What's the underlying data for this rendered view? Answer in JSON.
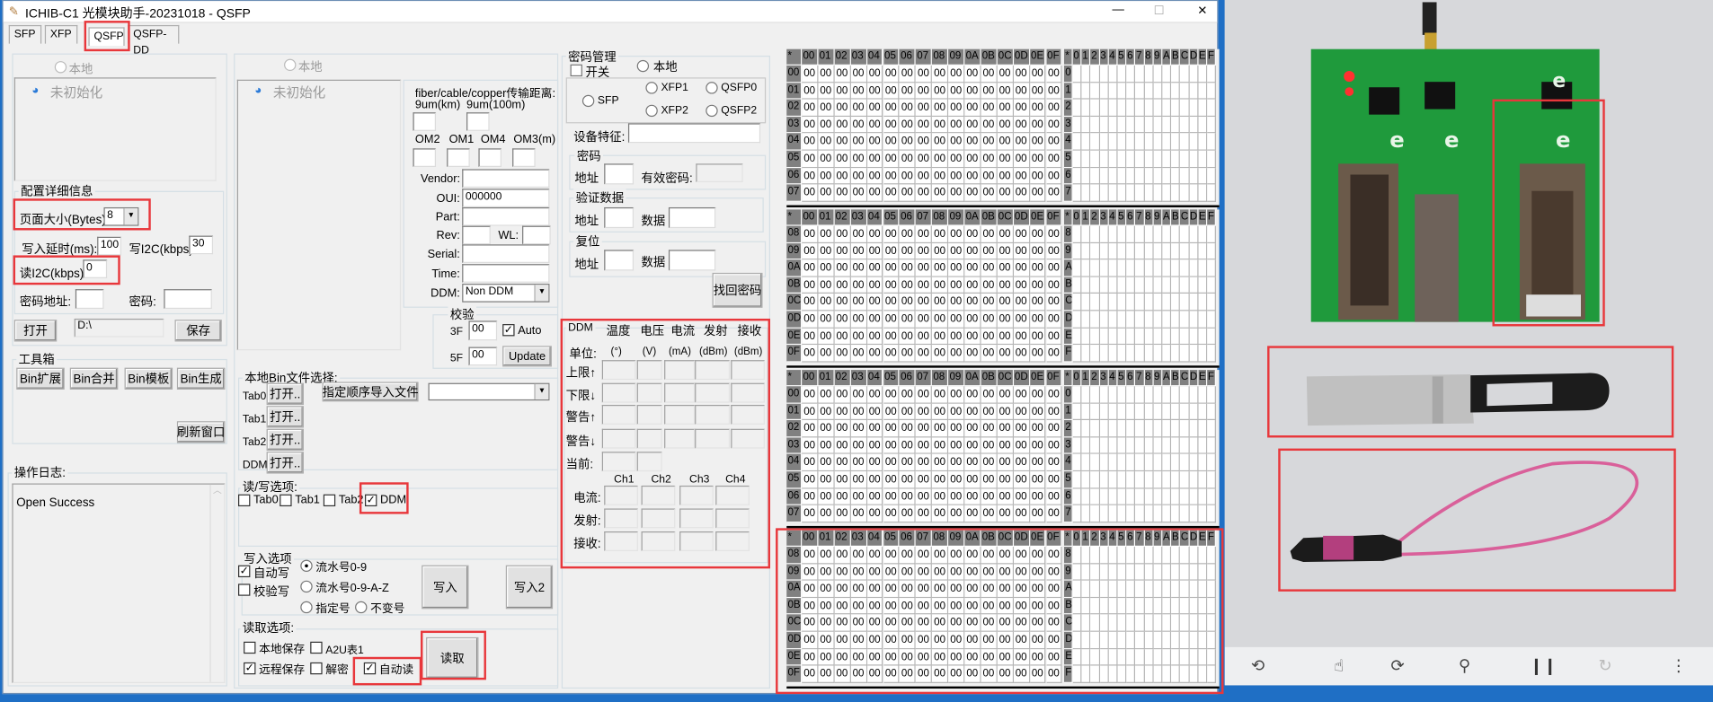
{
  "window": {
    "title": "ICHIB-C1 光模块助手-20231018  - QSFP",
    "min": "—",
    "max": "☐",
    "close": "✕"
  },
  "tabs": [
    {
      "label": "SFP"
    },
    {
      "label": "XFP"
    },
    {
      "label": "QSFP",
      "active": true
    },
    {
      "label": "QSFP-DD"
    }
  ],
  "left": {
    "local_radio": "本地",
    "tree_item": "未初始化",
    "config": {
      "legend": "配置详细信息",
      "page_size_label": "页面大小(Bytes):",
      "page_size": "8",
      "write_delay_label": "写入延时(ms):",
      "write_delay": "100",
      "write_i2c_label": "写I2C(kbps):",
      "write_i2c": "30",
      "read_i2c_label": "读I2C(kbps):",
      "read_i2c": "0",
      "pwd_addr_label": "密码地址:",
      "pwd_addr": "",
      "pwd_label": "密码:",
      "pwd": ""
    },
    "open_btn": "打开",
    "path": "D:\\",
    "save_btn": "保存",
    "toolbox": {
      "legend": "工具箱",
      "buttons": [
        "Bin扩展",
        "Bin合并",
        "Bin模板",
        "Bin生成"
      ],
      "refresh": "刷新窗口"
    },
    "log": {
      "legend": "操作日志:",
      "text": "Open Success"
    }
  },
  "middle": {
    "local_radio": "本地",
    "tree_item": "未初始化",
    "info": {
      "distance_title": "fiber/cable/copper传输距离:",
      "sm_km": "9um(km)",
      "sm_100m": "9um(100m)",
      "om2": "OM2",
      "om1": "OM1",
      "om4": "OM4",
      "om3": "OM3(m)",
      "vendor_label": "Vendor:",
      "vendor": "",
      "oui_label": "OUI:",
      "oui": "000000",
      "part_label": "Part:",
      "part": "",
      "rev_label": "Rev:",
      "rev": "",
      "wl_label": "WL:",
      "wl": "",
      "serial_label": "Serial:",
      "serial": "",
      "time_label": "Time:",
      "time": "",
      "ddm_label": "DDM:",
      "ddm": "Non DDM"
    },
    "checksum": {
      "legend": "校验",
      "f3_label": "3F",
      "f3": "00",
      "auto_label": "Auto",
      "auto": true,
      "f5_label": "5F",
      "f5": "00",
      "update_btn": "Update"
    },
    "bin": {
      "legend": "本地Bin文件选择:",
      "rows": [
        {
          "label": "Tab0",
          "btn": "打开.."
        },
        {
          "label": "Tab1",
          "btn": "打开.."
        },
        {
          "label": "Tab2",
          "btn": "打开.."
        },
        {
          "label": "DDM",
          "btn": "打开.."
        }
      ],
      "import_btn": "指定顺序导入文件",
      "import_select": ""
    },
    "rw": {
      "legend": "读/写选项:",
      "items": [
        {
          "label": "Tab0",
          "checked": false
        },
        {
          "label": "Tab1",
          "checked": false
        },
        {
          "label": "Tab2",
          "checked": false
        },
        {
          "label": "DDM",
          "checked": true
        }
      ]
    },
    "write": {
      "legend": "写入选项",
      "auto_write": "自动写",
      "verify_write": "校验写",
      "serial_09": "流水号0-9",
      "serial_09az": "流水号0-9-A-Z",
      "fixed": "指定号",
      "unchanged": "不变号",
      "write_btn": "写入",
      "write2_btn": "写入2"
    },
    "read": {
      "legend": "读取选项:",
      "local_save": "本地保存",
      "a2u": "A2U表1",
      "remote_save": "远程保存",
      "decrypt": "解密",
      "auto_read": "自动读",
      "read_btn": "读取"
    }
  },
  "password": {
    "legend": "密码管理",
    "switch": "开关",
    "local": "本地",
    "modules": {
      "sfp": "SFP",
      "xfp1": "XFP1",
      "xfp2": "XFP2",
      "qsfp0": "QSFP0",
      "qsfp2": "QSFP2"
    },
    "device_label": "设备特征:",
    "device": "",
    "pwd": {
      "legend": "密码",
      "addr_label": "地址",
      "valid_label": "有效密码:"
    },
    "verify": {
      "legend": "验证数据",
      "addr_label": "地址",
      "data_label": "数据"
    },
    "reset": {
      "legend": "复位",
      "addr_label": "地址",
      "data_label": "数据"
    },
    "recover_btn": "找回密码"
  },
  "ddm": {
    "legend": "DDM",
    "headers": [
      "温度",
      "电压",
      "电流",
      "发射",
      "接收"
    ],
    "unit_label": "单位:",
    "units": [
      "(°)",
      "(V)",
      "(mA)",
      "(dBm)",
      "(dBm)"
    ],
    "rows": [
      "上限↑",
      "下限↓",
      "警告↑",
      "警告↓"
    ],
    "current_label": "当前:",
    "channels": [
      "Ch1",
      "Ch2",
      "Ch3",
      "Ch4"
    ],
    "ch_rows": [
      "电流:",
      "发射:",
      "接收:"
    ]
  },
  "hex": {
    "corner": "*",
    "col_headers": [
      "00",
      "01",
      "02",
      "03",
      "04",
      "05",
      "06",
      "07",
      "08",
      "09",
      "0A",
      "0B",
      "0C",
      "0D",
      "0E",
      "0F"
    ],
    "ascii_headers": [
      "0",
      "1",
      "2",
      "3",
      "4",
      "5",
      "6",
      "7",
      "8",
      "9",
      "A",
      "B",
      "C",
      "D",
      "E",
      "F"
    ],
    "blocks": [
      {
        "rows": [
          {
            "label": "00",
            "ascii_label": "0",
            "values": [
              "00",
              "00",
              "00",
              "00",
              "00",
              "00",
              "00",
              "00",
              "00",
              "00",
              "00",
              "00",
              "00",
              "00",
              "00",
              "00"
            ]
          },
          {
            "label": "01",
            "ascii_label": "1",
            "values": [
              "00",
              "00",
              "00",
              "00",
              "00",
              "00",
              "00",
              "00",
              "00",
              "00",
              "00",
              "00",
              "00",
              "00",
              "00",
              "00"
            ]
          },
          {
            "label": "02",
            "ascii_label": "2",
            "values": [
              "00",
              "00",
              "00",
              "00",
              "00",
              "00",
              "00",
              "00",
              "00",
              "00",
              "00",
              "00",
              "00",
              "00",
              "00",
              "00"
            ]
          },
          {
            "label": "03",
            "ascii_label": "3",
            "values": [
              "00",
              "00",
              "00",
              "00",
              "00",
              "00",
              "00",
              "00",
              "00",
              "00",
              "00",
              "00",
              "00",
              "00",
              "00",
              "00"
            ]
          },
          {
            "label": "04",
            "ascii_label": "4",
            "values": [
              "00",
              "00",
              "00",
              "00",
              "00",
              "00",
              "00",
              "00",
              "00",
              "00",
              "00",
              "00",
              "00",
              "00",
              "00",
              "00"
            ]
          },
          {
            "label": "05",
            "ascii_label": "5",
            "values": [
              "00",
              "00",
              "00",
              "00",
              "00",
              "00",
              "00",
              "00",
              "00",
              "00",
              "00",
              "00",
              "00",
              "00",
              "00",
              "00"
            ]
          },
          {
            "label": "06",
            "ascii_label": "6",
            "values": [
              "00",
              "00",
              "00",
              "00",
              "00",
              "00",
              "00",
              "00",
              "00",
              "00",
              "00",
              "00",
              "00",
              "00",
              "00",
              "00"
            ]
          },
          {
            "label": "07",
            "ascii_label": "7",
            "values": [
              "00",
              "00",
              "00",
              "00",
              "00",
              "00",
              "00",
              "00",
              "00",
              "00",
              "00",
              "00",
              "00",
              "00",
              "00",
              "00"
            ]
          }
        ]
      },
      {
        "rows": [
          {
            "label": "08",
            "ascii_label": "8",
            "values": [
              "00",
              "00",
              "00",
              "00",
              "00",
              "00",
              "00",
              "00",
              "00",
              "00",
              "00",
              "00",
              "00",
              "00",
              "00",
              "00"
            ]
          },
          {
            "label": "09",
            "ascii_label": "9",
            "values": [
              "00",
              "00",
              "00",
              "00",
              "00",
              "00",
              "00",
              "00",
              "00",
              "00",
              "00",
              "00",
              "00",
              "00",
              "00",
              "00"
            ]
          },
          {
            "label": "0A",
            "ascii_label": "A",
            "values": [
              "00",
              "00",
              "00",
              "00",
              "00",
              "00",
              "00",
              "00",
              "00",
              "00",
              "00",
              "00",
              "00",
              "00",
              "00",
              "00"
            ]
          },
          {
            "label": "0B",
            "ascii_label": "B",
            "values": [
              "00",
              "00",
              "00",
              "00",
              "00",
              "00",
              "00",
              "00",
              "00",
              "00",
              "00",
              "00",
              "00",
              "00",
              "00",
              "00"
            ]
          },
          {
            "label": "0C",
            "ascii_label": "C",
            "values": [
              "00",
              "00",
              "00",
              "00",
              "00",
              "00",
              "00",
              "00",
              "00",
              "00",
              "00",
              "00",
              "00",
              "00",
              "00",
              "00"
            ]
          },
          {
            "label": "0D",
            "ascii_label": "D",
            "values": [
              "00",
              "00",
              "00",
              "00",
              "00",
              "00",
              "00",
              "00",
              "00",
              "00",
              "00",
              "00",
              "00",
              "00",
              "00",
              "00"
            ]
          },
          {
            "label": "0E",
            "ascii_label": "E",
            "values": [
              "00",
              "00",
              "00",
              "00",
              "00",
              "00",
              "00",
              "00",
              "00",
              "00",
              "00",
              "00",
              "00",
              "00",
              "00",
              "00"
            ]
          },
          {
            "label": "0F",
            "ascii_label": "F",
            "values": [
              "00",
              "00",
              "00",
              "00",
              "00",
              "00",
              "00",
              "00",
              "00",
              "00",
              "00",
              "00",
              "00",
              "00",
              "00",
              "00"
            ]
          }
        ]
      },
      {
        "rows": [
          {
            "label": "00",
            "ascii_label": "0",
            "values": [
              "00",
              "00",
              "00",
              "00",
              "00",
              "00",
              "00",
              "00",
              "00",
              "00",
              "00",
              "00",
              "00",
              "00",
              "00",
              "00"
            ]
          },
          {
            "label": "01",
            "ascii_label": "1",
            "values": [
              "00",
              "00",
              "00",
              "00",
              "00",
              "00",
              "00",
              "00",
              "00",
              "00",
              "00",
              "00",
              "00",
              "00",
              "00",
              "00"
            ]
          },
          {
            "label": "02",
            "ascii_label": "2",
            "values": [
              "00",
              "00",
              "00",
              "00",
              "00",
              "00",
              "00",
              "00",
              "00",
              "00",
              "00",
              "00",
              "00",
              "00",
              "00",
              "00"
            ]
          },
          {
            "label": "03",
            "ascii_label": "3",
            "values": [
              "00",
              "00",
              "00",
              "00",
              "00",
              "00",
              "00",
              "00",
              "00",
              "00",
              "00",
              "00",
              "00",
              "00",
              "00",
              "00"
            ]
          },
          {
            "label": "04",
            "ascii_label": "4",
            "values": [
              "00",
              "00",
              "00",
              "00",
              "00",
              "00",
              "00",
              "00",
              "00",
              "00",
              "00",
              "00",
              "00",
              "00",
              "00",
              "00"
            ]
          },
          {
            "label": "05",
            "ascii_label": "5",
            "values": [
              "00",
              "00",
              "00",
              "00",
              "00",
              "00",
              "00",
              "00",
              "00",
              "00",
              "00",
              "00",
              "00",
              "00",
              "00",
              "00"
            ]
          },
          {
            "label": "06",
            "ascii_label": "6",
            "values": [
              "00",
              "00",
              "00",
              "00",
              "00",
              "00",
              "00",
              "00",
              "00",
              "00",
              "00",
              "00",
              "00",
              "00",
              "00",
              "00"
            ]
          },
          {
            "label": "07",
            "ascii_label": "7",
            "values": [
              "00",
              "00",
              "00",
              "00",
              "00",
              "00",
              "00",
              "00",
              "00",
              "00",
              "00",
              "00",
              "00",
              "00",
              "00",
              "00"
            ]
          }
        ]
      },
      {
        "rows": [
          {
            "label": "08",
            "ascii_label": "8",
            "values": [
              "00",
              "00",
              "00",
              "00",
              "00",
              "00",
              "00",
              "00",
              "00",
              "00",
              "00",
              "00",
              "00",
              "00",
              "00",
              "00"
            ]
          },
          {
            "label": "09",
            "ascii_label": "9",
            "values": [
              "00",
              "00",
              "00",
              "00",
              "00",
              "00",
              "00",
              "00",
              "00",
              "00",
              "00",
              "00",
              "00",
              "00",
              "00",
              "00"
            ]
          },
          {
            "label": "0A",
            "ascii_label": "A",
            "values": [
              "00",
              "00",
              "00",
              "00",
              "00",
              "00",
              "00",
              "00",
              "00",
              "00",
              "00",
              "00",
              "00",
              "00",
              "00",
              "00"
            ]
          },
          {
            "label": "0B",
            "ascii_label": "B",
            "values": [
              "00",
              "00",
              "00",
              "00",
              "00",
              "00",
              "00",
              "00",
              "00",
              "00",
              "00",
              "00",
              "00",
              "00",
              "00",
              "00"
            ]
          },
          {
            "label": "0C",
            "ascii_label": "C",
            "values": [
              "00",
              "00",
              "00",
              "00",
              "00",
              "00",
              "00",
              "00",
              "00",
              "00",
              "00",
              "00",
              "00",
              "00",
              "00",
              "00"
            ]
          },
          {
            "label": "0D",
            "ascii_label": "D",
            "values": [
              "00",
              "00",
              "00",
              "00",
              "00",
              "00",
              "00",
              "00",
              "00",
              "00",
              "00",
              "00",
              "00",
              "00",
              "00",
              "00"
            ]
          },
          {
            "label": "0E",
            "ascii_label": "E",
            "values": [
              "00",
              "00",
              "00",
              "00",
              "00",
              "00",
              "00",
              "00",
              "00",
              "00",
              "00",
              "00",
              "00",
              "00",
              "00",
              "00"
            ]
          },
          {
            "label": "0F",
            "ascii_label": "F",
            "values": [
              "00",
              "00",
              "00",
              "00",
              "00",
              "00",
              "00",
              "00",
              "00",
              "00",
              "00",
              "00",
              "00",
              "00",
              "00",
              "00"
            ]
          }
        ]
      }
    ]
  },
  "camera": {
    "toolbar_icons": [
      "rotate-screen-icon",
      "touch-icon",
      "switch-camera-icon",
      "flashlight-icon",
      "pause-icon",
      "refresh-icon",
      "more-icon"
    ]
  },
  "colors": {
    "highlight": "#e8373b",
    "pcb": "#1f9a3c",
    "cable": "#d9609a",
    "grid_header": "#808080"
  }
}
